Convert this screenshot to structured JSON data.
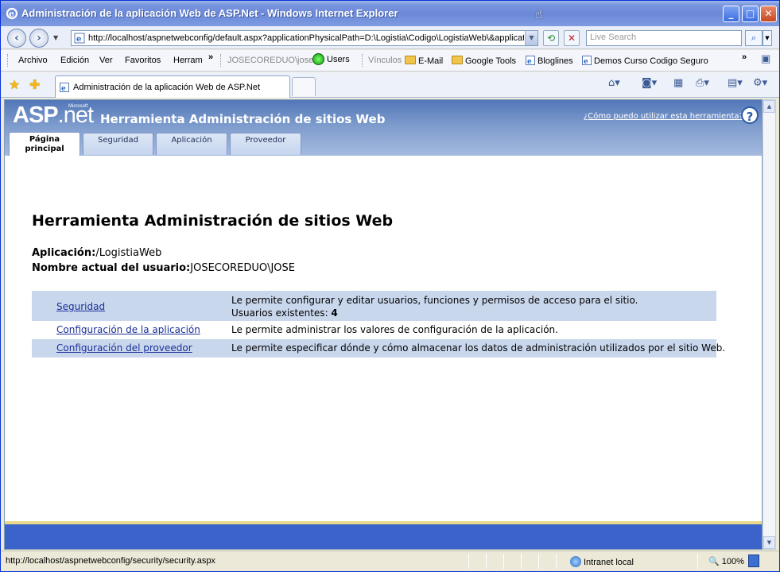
{
  "window": {
    "title": "Administración de la aplicación Web de ASP.Net - Windows Internet Explorer"
  },
  "address": {
    "url": "http://localhost/aspnetwebconfig/default.aspx?applicationPhysicalPath=D:\\Logistia\\Codigo\\LogistiaWeb\\&applicat",
    "search_placeholder": "Live Search"
  },
  "menu": {
    "items": [
      "Archivo",
      "Edición",
      "Ver",
      "Favoritos",
      "Herram"
    ],
    "user": "JOSECOREDUO\\jose",
    "users": "Users",
    "links_label": "Vínculos",
    "links": [
      "E-Mail",
      "Google Tools",
      "Bloglines",
      "Demos Curso Codigo Seguro"
    ]
  },
  "tabs": {
    "active_tab": "Administración de la aplicación Web de ASP.Net"
  },
  "banner": {
    "logo_asp": "ASP",
    "logo_net": ".net",
    "logo_ms": "Microsoft",
    "title": "Herramienta Administración de sitios Web",
    "help_link": "¿Cómo puedo utilizar esta herramienta?",
    "help_icon": "?"
  },
  "app_tabs": [
    {
      "label": "Página principal"
    },
    {
      "label": "Seguridad"
    },
    {
      "label": "Aplicación"
    },
    {
      "label": "Proveedor"
    }
  ],
  "main": {
    "heading": "Herramienta Administración de sitios Web",
    "app_label": "Aplicación:",
    "app_value": "/LogistiaWeb",
    "user_label": "Nombre actual del usuario:",
    "user_value": "JOSECOREDUO\\JOSE",
    "rows": [
      {
        "link": "Seguridad",
        "desc": "Le permite configurar y editar usuarios, funciones y permisos de acceso para el sitio.",
        "extra_label": "Usuarios existentes: ",
        "extra_value": "4"
      },
      {
        "link": "Configuración de la aplicación",
        "desc": "Le permite administrar los valores de configuración de la aplicación."
      },
      {
        "link": "Configuración del proveedor",
        "desc": "Le permite especificar dónde y cómo almacenar los datos de administración utilizados por el sitio Web."
      }
    ]
  },
  "status": {
    "text": "http://localhost/aspnetwebconfig/security/security.aspx",
    "zone": "Intranet local",
    "zoom": "100%"
  }
}
